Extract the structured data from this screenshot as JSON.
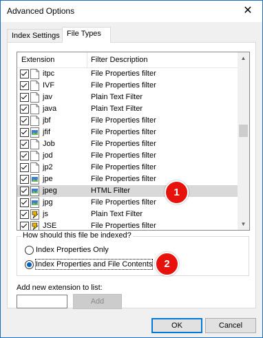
{
  "window": {
    "title": "Advanced Options",
    "close_glyph": "✕"
  },
  "tabs": [
    {
      "label": "Index Settings",
      "active": false
    },
    {
      "label": "File Types",
      "active": true
    }
  ],
  "list": {
    "columns": [
      "Extension",
      "Filter Description"
    ],
    "rows": [
      {
        "ext": "itpc",
        "desc": "File Properties filter",
        "checked": true,
        "icon": "file-icon"
      },
      {
        "ext": "IVF",
        "desc": "File Properties filter",
        "checked": true,
        "icon": "file-icon"
      },
      {
        "ext": "jav",
        "desc": "Plain Text Filter",
        "checked": true,
        "icon": "file-icon"
      },
      {
        "ext": "java",
        "desc": "Plain Text Filter",
        "checked": true,
        "icon": "file-icon"
      },
      {
        "ext": "jbf",
        "desc": "File Properties filter",
        "checked": true,
        "icon": "file-icon"
      },
      {
        "ext": "jfif",
        "desc": "File Properties filter",
        "checked": true,
        "icon": "image-file-icon"
      },
      {
        "ext": "Job",
        "desc": "File Properties filter",
        "checked": true,
        "icon": "file-icon"
      },
      {
        "ext": "jod",
        "desc": "File Properties filter",
        "checked": true,
        "icon": "file-icon"
      },
      {
        "ext": "jp2",
        "desc": "File Properties filter",
        "checked": true,
        "icon": "file-icon"
      },
      {
        "ext": "jpe",
        "desc": "File Properties filter",
        "checked": true,
        "icon": "image-file-icon"
      },
      {
        "ext": "jpeg",
        "desc": "HTML Filter",
        "checked": true,
        "icon": "image-file-icon",
        "selected": true
      },
      {
        "ext": "jpg",
        "desc": "File Properties filter",
        "checked": true,
        "icon": "image-file-icon"
      },
      {
        "ext": "js",
        "desc": "Plain Text Filter",
        "checked": true,
        "icon": "script-file-icon"
      },
      {
        "ext": "JSE",
        "desc": "File Properties filter",
        "checked": true,
        "icon": "script-file-icon"
      }
    ]
  },
  "index_group": {
    "label": "How should this file be indexed?",
    "options": [
      {
        "label": "Index Properties Only",
        "selected": false
      },
      {
        "label": "Index Properties and File Contents",
        "selected": true
      }
    ]
  },
  "add_extension": {
    "label": "Add new extension to list:",
    "value": "",
    "button": "Add"
  },
  "buttons": {
    "ok": "OK",
    "cancel": "Cancel"
  },
  "badges": [
    "1",
    "2"
  ],
  "colors": {
    "badge": "#e8120d",
    "accent": "#0078d7",
    "selection": "#d9d9d9"
  }
}
